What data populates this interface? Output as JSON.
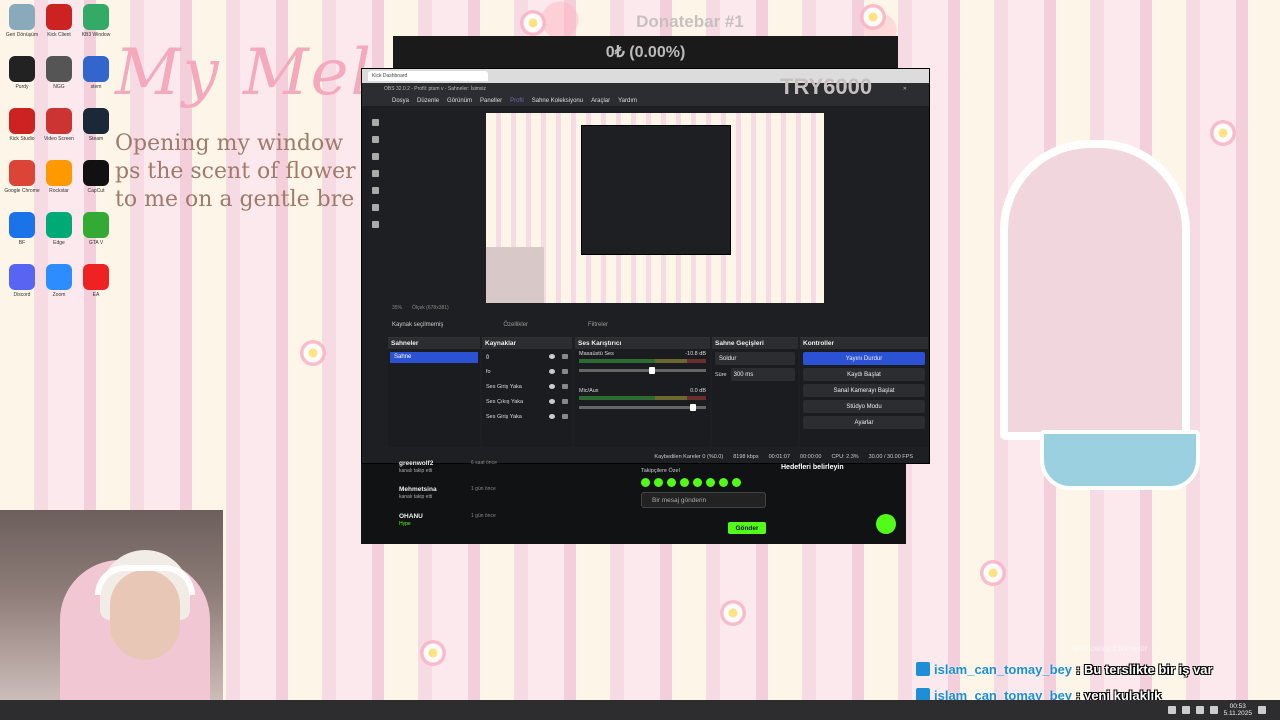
{
  "wallpaper": {
    "title_art": "My Mel",
    "poem": [
      "Opening my window",
      "ps the scent of flower",
      "to me on a gentle bre"
    ]
  },
  "desktop_icons": [
    {
      "label": "Geri Dönüşüm",
      "color": "#8ab"
    },
    {
      "label": "Kick Client",
      "color": "#c22"
    },
    {
      "label": "KB3 Window",
      "color": "#3a6"
    },
    {
      "label": "Purdy",
      "color": "#222"
    },
    {
      "label": "NGG",
      "color": "#555"
    },
    {
      "label": "stem",
      "color": "#36c"
    },
    {
      "label": "Kick Studio",
      "color": "#c22"
    },
    {
      "label": "Video Screen",
      "color": "#c33"
    },
    {
      "label": "Steam",
      "color": "#1b2838"
    },
    {
      "label": "Google Chrome",
      "color": "#db4437"
    },
    {
      "label": "Rockstar",
      "color": "#f90"
    },
    {
      "label": "CapCut",
      "color": "#111"
    },
    {
      "label": "BF",
      "color": "#1a73e8"
    },
    {
      "label": "Edge",
      "color": "#0a7"
    },
    {
      "label": "GTA V",
      "color": "#3a3"
    },
    {
      "label": "Discord",
      "color": "#5865f2"
    },
    {
      "label": "Zoom",
      "color": "#2d8cff"
    },
    {
      "label": "EA",
      "color": "#e22"
    }
  ],
  "donatebar": {
    "title": "Donatebar #1",
    "amount": "0₺ (0.00%)",
    "goal": "TRY6000"
  },
  "obs": {
    "browser_tab": "Kick Dashboard",
    "window_title": "OBS 32.0.2 - Profil: ptum v - Sahneler: İsimsiz",
    "menu": [
      "Dosya",
      "Düzenle",
      "Görünüm",
      "Paneller",
      "Profil",
      "Sahne Koleksiyonu",
      "Araçlar",
      "Yardım"
    ],
    "zoom": "35%",
    "scale_info": "Ölçek (678x381)",
    "source_bar": {
      "none_selected": "Kaynak seçilmemiş",
      "properties": "Özellikler",
      "filters": "Filtreler"
    },
    "scenes": {
      "title": "Sahneler",
      "items": [
        "Sahne"
      ]
    },
    "sources": {
      "title": "Kaynaklar",
      "items": [
        "ğ",
        "fo",
        "Ses Giriş Yaka",
        "Ses Çıkış Yaka",
        "Ses Giriş Yaka"
      ]
    },
    "mixer": {
      "title": "Ses Karıştırıcı",
      "channels": [
        {
          "name": "Masaüstü Ses",
          "db": "-10.8 dB",
          "level": 0.6
        },
        {
          "name": "Mic/Aux",
          "db": "0.0 dB",
          "level": 0.95
        }
      ]
    },
    "transitions": {
      "title": "Sahne Geçişleri",
      "type": "Soldur",
      "duration_label": "Süre",
      "duration": "300 ms"
    },
    "controls": {
      "title": "Kontroller",
      "buttons": [
        "Yayını Durdur",
        "Kaydı Başlat",
        "Sanal Kamerayı Başlat",
        "Stüdyo Modu",
        "Ayarlar"
      ]
    },
    "status": {
      "dropped": "Kaybedilen Kareler 0 (%0.0)",
      "bitrate": "8198 kbps",
      "live_time": "00:01:07",
      "rec_time": "00:00:00",
      "cpu": "CPU: 2.3%",
      "fps": "30.00 / 30.00 FPS"
    }
  },
  "kick_panel": {
    "follows": [
      {
        "name": "greenwolf2",
        "sub": "kanalı takip etti",
        "ago": "6 saat önce"
      },
      {
        "name": "Mehmetsina",
        "sub": "kanalı takip etti",
        "ago": "1 gün önce"
      },
      {
        "name": "OHANU",
        "sub": "Hype",
        "ago": "1 gün önce"
      }
    ],
    "followers_only": "Takipçilere Özel",
    "message_placeholder": "Bir mesaj gönderin",
    "send": "Gönder",
    "goals": "Hedefleri belirleyin"
  },
  "chat_overlay": [
    {
      "user": "islam_can_tomay_bey",
      "message": ": Bu terslikte bir iş var"
    },
    {
      "user": "islam_can_tomay_bey",
      "message": ": yeni kulaklık"
    }
  ],
  "taskbar": {
    "time": "00:53",
    "date": "5.11.2025"
  },
  "watermark": "Windows'u Etkinleştir"
}
